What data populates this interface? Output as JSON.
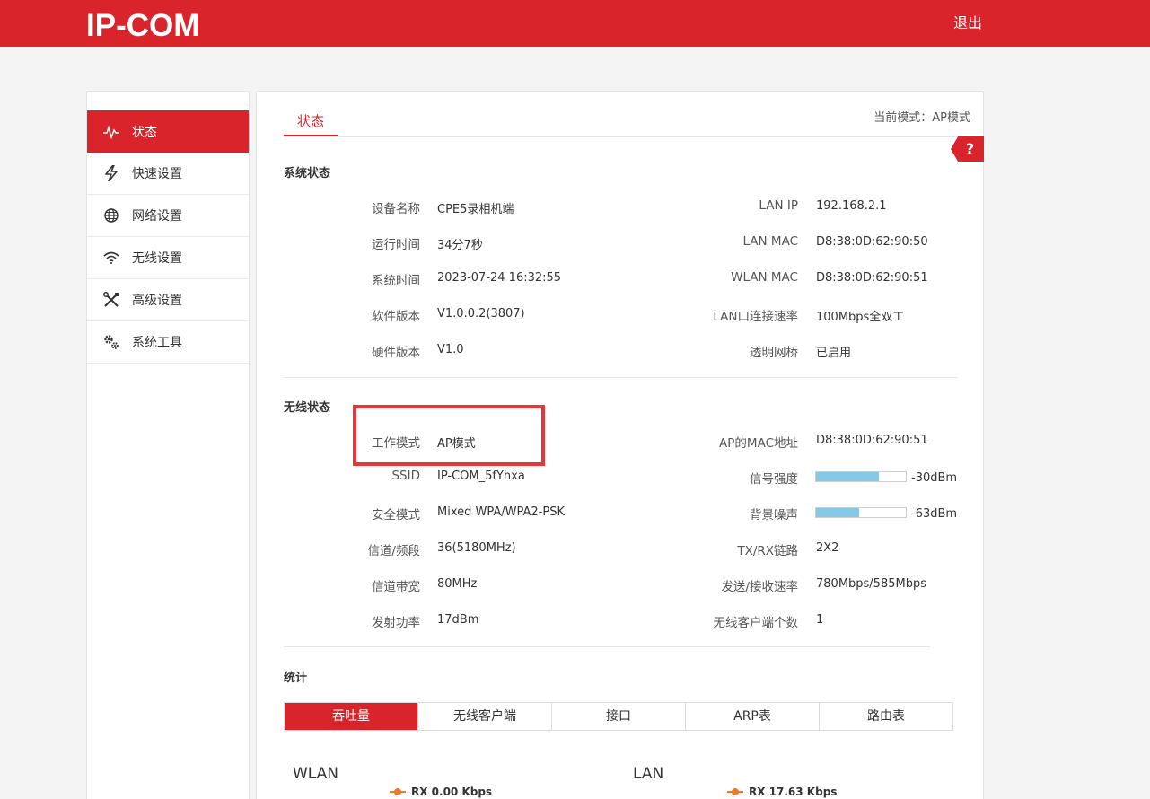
{
  "header": {
    "logo": "IP-COM",
    "logout": "退出"
  },
  "sidebar": {
    "items": [
      {
        "label": "状态",
        "icon": "pulse-icon"
      },
      {
        "label": "快速设置",
        "icon": "lightning-icon"
      },
      {
        "label": "网络设置",
        "icon": "globe-icon"
      },
      {
        "label": "无线设置",
        "icon": "wifi-icon"
      },
      {
        "label": "高级设置",
        "icon": "tools-icon"
      },
      {
        "label": "系统工具",
        "icon": "gears-icon"
      }
    ]
  },
  "main": {
    "tab": "状态",
    "mode_text": "当前模式：AP模式",
    "help": "?",
    "system": {
      "title": "系统状态",
      "left": [
        {
          "label": "设备名称",
          "value": "CPE5录相机端"
        },
        {
          "label": "运行时间",
          "value": "34分7秒"
        },
        {
          "label": "系统时间",
          "value": "2023-07-24 16:32:55"
        },
        {
          "label": "软件版本",
          "value": "V1.0.0.2(3807)"
        },
        {
          "label": "硬件版本",
          "value": "V1.0"
        }
      ],
      "right": [
        {
          "label": "LAN IP",
          "value": "192.168.2.1"
        },
        {
          "label": "LAN MAC",
          "value": "D8:38:0D:62:90:50"
        },
        {
          "label": "WLAN MAC",
          "value": "D8:38:0D:62:90:51"
        },
        {
          "label": "LAN口连接速率",
          "value": "100Mbps全双工"
        },
        {
          "label": "透明网桥",
          "value": "已启用"
        }
      ]
    },
    "wireless": {
      "title": "无线状态",
      "left": [
        {
          "label": "工作模式",
          "value": "AP模式"
        },
        {
          "label": "SSID",
          "value": "IP-COM_5fYhxa"
        },
        {
          "label": "安全模式",
          "value": "Mixed WPA/WPA2-PSK"
        },
        {
          "label": "信道/频段",
          "value": "36(5180MHz)"
        },
        {
          "label": "信道带宽",
          "value": "80MHz"
        },
        {
          "label": "发射功率",
          "value": "17dBm"
        }
      ],
      "right": [
        {
          "label": "AP的MAC地址",
          "value": "D8:38:0D:62:90:51"
        },
        {
          "label": "信号强度",
          "value": "-30dBm",
          "bar_fraction": 0.7
        },
        {
          "label": "背景噪声",
          "value": "-63dBm",
          "bar_fraction": 0.48
        },
        {
          "label": "TX/RX链路",
          "value": "2X2"
        },
        {
          "label": "发送/接收速率",
          "value": "780Mbps/585Mbps"
        },
        {
          "label": "无线客户端个数",
          "value": "1"
        }
      ]
    },
    "stats": {
      "title": "统计",
      "tabs": [
        "吞吐量",
        "无线客户端",
        "接口",
        "ARP表",
        "路由表"
      ],
      "charts": [
        {
          "title": "WLAN",
          "legend": "RX 0.00 Kbps"
        },
        {
          "title": "LAN",
          "legend": "RX 17.63 Kbps"
        }
      ]
    }
  },
  "colors": {
    "brand": "#d9242b",
    "bar": "#87c8e6",
    "highlight": "#e8353a",
    "legend": "#f07a2c"
  }
}
